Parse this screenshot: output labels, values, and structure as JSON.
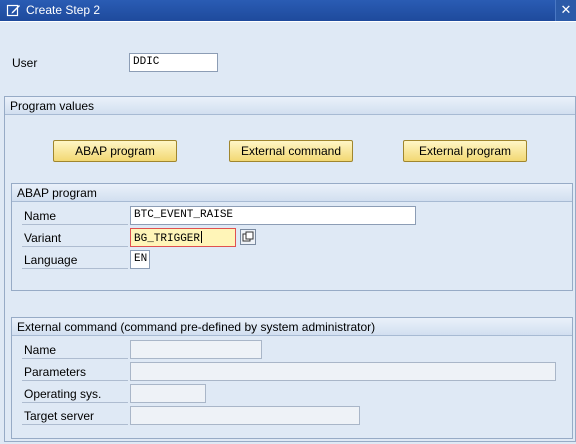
{
  "window": {
    "title": "Create Step  2",
    "close_glyph": "✕"
  },
  "user": {
    "label": "User",
    "value": "DDIC"
  },
  "program_values": {
    "title": "Program values",
    "buttons": {
      "abap": "ABAP program",
      "external_command": "External command",
      "external_program": "External program"
    }
  },
  "abap_program": {
    "title": "ABAP program",
    "name_label": "Name",
    "name_value": "BTC_EVENT_RAISE",
    "variant_label": "Variant",
    "variant_value": "BG_TRIGGER",
    "language_label": "Language",
    "language_value": "EN"
  },
  "external_command": {
    "title": "External command (command pre-defined by system administrator)",
    "name_label": "Name",
    "name_value": "",
    "parameters_label": "Parameters",
    "parameters_value": "",
    "os_label": "Operating sys.",
    "os_value": "",
    "target_label": "Target server",
    "target_value": ""
  },
  "colors": {
    "title_bar": "#1e4a9c",
    "background": "#dfe9f5",
    "button": "#f2d873",
    "focus_field": "#fff5b8"
  }
}
